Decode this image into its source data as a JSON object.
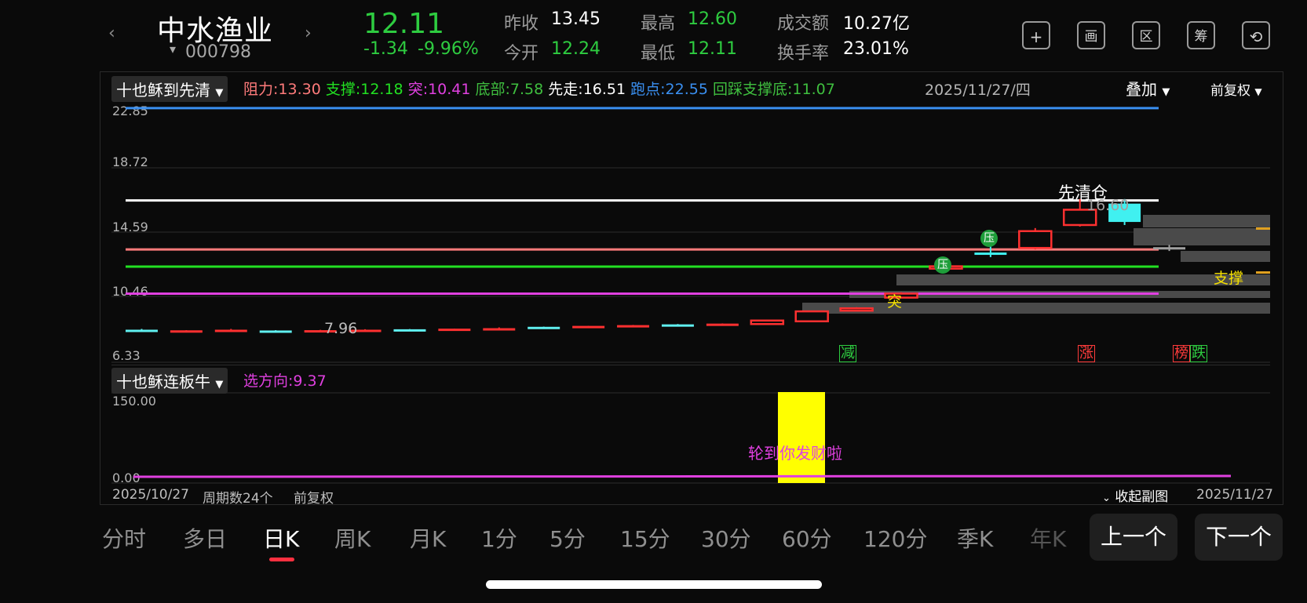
{
  "header": {
    "prev_arrow": "‹",
    "next_arrow": "›",
    "stock_name": "中水渔业",
    "stock_code": "000798",
    "code_caret": "▾",
    "price": "12.11",
    "change": "-1.34",
    "change_pct": "-9.96%",
    "stats": [
      {
        "label": "昨收",
        "value": "13.45",
        "color": "#ffffff"
      },
      {
        "label": "今开",
        "value": "12.24",
        "color": "#2ecc40"
      },
      {
        "label": "最高",
        "value": "12.60",
        "color": "#2ecc40"
      },
      {
        "label": "最低",
        "value": "12.11",
        "color": "#2ecc40"
      },
      {
        "label": "成交额",
        "value": "10.27亿",
        "color": "#ffffff"
      },
      {
        "label": "换手率",
        "value": "23.01%",
        "color": "#ffffff"
      }
    ],
    "tools": [
      {
        "name": "add",
        "glyph": "+"
      },
      {
        "name": "draw",
        "glyph": "画"
      },
      {
        "name": "range",
        "glyph": "区"
      },
      {
        "name": "chips",
        "glyph": "筹"
      },
      {
        "name": "rotate",
        "glyph": "⟲"
      }
    ]
  },
  "main_indicator": {
    "name": "十也稣到先清",
    "items": [
      {
        "label": "阻力:13.30",
        "color": "#ff7b7b"
      },
      {
        "label": "支撑:12.18",
        "color": "#22e022"
      },
      {
        "label": "突:10.41",
        "color": "#e040e0"
      },
      {
        "label": "底部:7.58",
        "color": "#3fbf3f"
      },
      {
        "label": "先走:16.51",
        "color": "#ffffff"
      },
      {
        "label": "跑点:22.55",
        "color": "#3a8ff0"
      },
      {
        "label": "回踩支撑底:11.07",
        "color": "#3fbf3f"
      }
    ],
    "date": "2025/11/27/四",
    "overlay_label": "叠加",
    "adjust_label": "前复权"
  },
  "price_axis": [
    "22.85",
    "18.72",
    "14.59",
    "10.46",
    "6.33"
  ],
  "annotations": {
    "clear_label": "先清仓",
    "high_label": "16.60",
    "low_label": "7.96",
    "support_label": "支撑",
    "breakout_label": "突",
    "press_label": "压",
    "marker_reduce": "减",
    "marker_rise": "涨",
    "marker_list": "榜",
    "marker_fall": "跌"
  },
  "sub_indicator": {
    "name": "十也稣连板牛",
    "items": [
      {
        "label": "选方向:9.37",
        "color": "#e040e0"
      }
    ],
    "axis": [
      "150.00",
      "0.00"
    ],
    "signal_text": "轮到你发财啦"
  },
  "chart_footer": {
    "start_date": "2025/10/27",
    "period_count": "周期数24个",
    "adjust": "前复权",
    "collapse": "收起副图",
    "end_date": "2025/11/27"
  },
  "periods": [
    {
      "label": "分时",
      "active": false
    },
    {
      "label": "多日",
      "active": false
    },
    {
      "label": "日K",
      "active": true
    },
    {
      "label": "周K",
      "active": false
    },
    {
      "label": "月K",
      "active": false
    },
    {
      "label": "1分",
      "active": false
    },
    {
      "label": "5分",
      "active": false
    },
    {
      "label": "15分",
      "active": false
    },
    {
      "label": "30分",
      "active": false
    },
    {
      "label": "60分",
      "active": false
    },
    {
      "label": "120分",
      "active": false
    },
    {
      "label": "季K",
      "active": false
    },
    {
      "label": "年K",
      "active": false
    }
  ],
  "nav_buttons": {
    "prev": "上一个",
    "next": "下一个"
  },
  "chart_data": {
    "type": "candlestick",
    "x_range": [
      "2025/10/27",
      "2025/11/27"
    ],
    "ylim": [
      6.33,
      22.85
    ],
    "ohlc": [
      {
        "o": 8.05,
        "h": 8.1,
        "l": 7.96,
        "c": 8.05
      },
      {
        "o": 8.0,
        "h": 8.02,
        "l": 7.98,
        "c": 8.01
      },
      {
        "o": 8.05,
        "h": 8.1,
        "l": 7.96,
        "c": 8.05
      },
      {
        "o": 8.0,
        "h": 8.02,
        "l": 7.97,
        "c": 8.0
      },
      {
        "o": 8.02,
        "h": 8.04,
        "l": 7.99,
        "c": 8.0
      },
      {
        "o": 8.05,
        "h": 8.08,
        "l": 8.0,
        "c": 8.04
      },
      {
        "o": 8.06,
        "h": 8.09,
        "l": 8.03,
        "c": 8.08
      },
      {
        "o": 8.1,
        "h": 8.12,
        "l": 8.08,
        "c": 8.12
      },
      {
        "o": 8.15,
        "h": 8.2,
        "l": 8.1,
        "c": 8.15
      },
      {
        "o": 8.2,
        "h": 8.25,
        "l": 8.18,
        "c": 8.24
      },
      {
        "o": 8.27,
        "h": 8.3,
        "l": 8.25,
        "c": 8.3
      },
      {
        "o": 8.33,
        "h": 8.36,
        "l": 8.3,
        "c": 8.35
      },
      {
        "o": 8.38,
        "h": 8.42,
        "l": 8.36,
        "c": 8.4
      },
      {
        "o": 8.43,
        "h": 8.46,
        "l": 8.4,
        "c": 8.45
      },
      {
        "o": 8.42,
        "h": 8.7,
        "l": 8.4,
        "c": 8.65
      },
      {
        "o": 8.6,
        "h": 9.3,
        "l": 8.55,
        "c": 9.25
      },
      {
        "o": 9.4,
        "h": 9.52,
        "l": 9.3,
        "c": 9.45
      },
      {
        "o": 10.15,
        "h": 10.5,
        "l": 10.1,
        "c": 10.41
      },
      {
        "o": 12.1,
        "h": 12.3,
        "l": 11.9,
        "c": 12.2
      },
      {
        "o": 13.1,
        "h": 13.5,
        "l": 12.8,
        "c": 13.0
      },
      {
        "o": 13.4,
        "h": 14.7,
        "l": 13.3,
        "c": 14.5
      },
      {
        "o": 14.9,
        "h": 16.6,
        "l": 14.8,
        "c": 15.9
      },
      {
        "o": 16.3,
        "h": 16.6,
        "l": 14.9,
        "c": 15.1
      },
      {
        "o": 13.45,
        "h": 13.6,
        "l": 13.2,
        "c": 13.4
      }
    ],
    "levels": [
      {
        "name": "跑点",
        "value": 22.55,
        "color": "#3a8ff0"
      },
      {
        "name": "先走",
        "value": 16.51,
        "color": "#ffffff"
      },
      {
        "name": "阻力",
        "value": 13.3,
        "color": "#ff7b7b"
      },
      {
        "name": "支撑",
        "value": 12.18,
        "color": "#22e022"
      },
      {
        "name": "突",
        "value": 10.41,
        "color": "#e040e0"
      }
    ],
    "sub_series": {
      "name": "选方向",
      "ylim": [
        0,
        150
      ],
      "signal_bar": {
        "index": 14,
        "value": 150
      }
    }
  }
}
